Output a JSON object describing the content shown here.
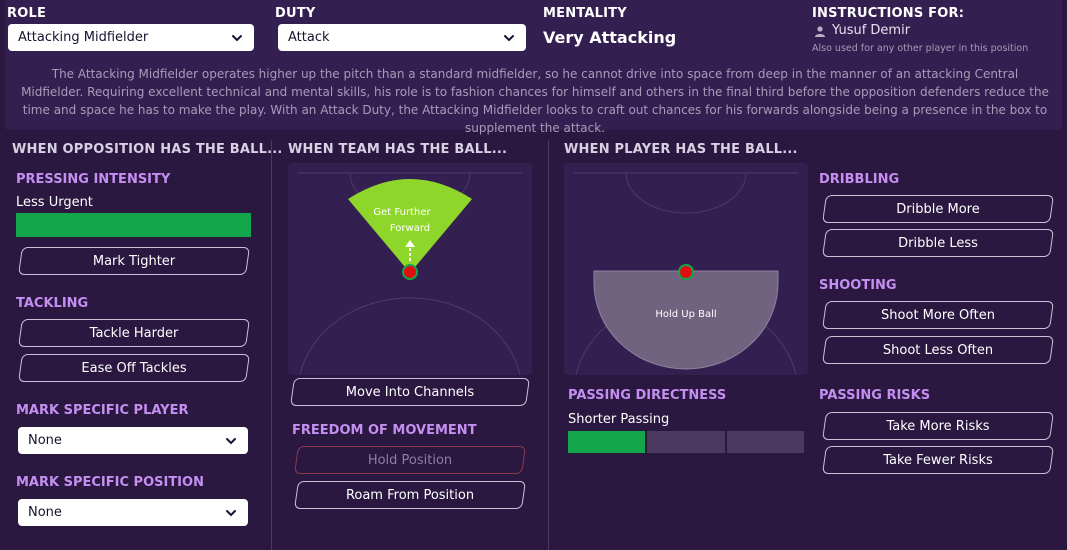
{
  "header": {
    "role_label": "ROLE",
    "role_value": "Attacking Midfielder",
    "duty_label": "DUTY",
    "duty_value": "Attack",
    "mentality_label": "MENTALITY",
    "mentality_value": "Very Attacking",
    "instructions_label": "INSTRUCTIONS FOR:",
    "player_name": "Yusuf Demir",
    "player_note": "Also used for any other player in this position"
  },
  "description": "The Attacking Midfielder operates higher up the pitch than a standard midfielder, so he cannot drive into space from deep in the manner of an attacking Central Midfielder. Requiring excellent technical and mental skills, his role is to fashion chances for himself and others in the final third before the opposition defenders reduce the time and space he has to make the play. With an Attack Duty, the Attacking Midfielder looks to craft out chances for his forwards alongside being a presence in the box to supplement the attack.",
  "opposition": {
    "title": "WHEN OPPOSITION HAS THE BALL...",
    "pressing_title": "PRESSING INTENSITY",
    "pressing_value": "Less Urgent",
    "pressing_level": 1.0,
    "mark_tighter": "Mark Tighter",
    "tackling_title": "TACKLING",
    "tackle_harder": "Tackle Harder",
    "ease_off": "Ease Off Tackles",
    "mark_player_title": "MARK SPECIFIC PLAYER",
    "mark_player_value": "None",
    "mark_position_title": "MARK SPECIFIC POSITION",
    "mark_position_value": "None"
  },
  "team": {
    "title": "WHEN TEAM HAS THE BALL...",
    "zone_label_1": "Get Further",
    "zone_label_2": "Forward",
    "channels": "Move Into Channels",
    "freedom_title": "FREEDOM OF MOVEMENT",
    "hold_position": "Hold Position",
    "roam": "Roam From Position"
  },
  "player": {
    "title": "WHEN PLAYER HAS THE BALL...",
    "hold_up": "Hold Up Ball",
    "passing_title": "PASSING DIRECTNESS",
    "passing_value": "Shorter Passing",
    "passing_level": 1,
    "passing_segments": 3,
    "dribbling_title": "DRIBBLING",
    "dribble_more": "Dribble More",
    "dribble_less": "Dribble Less",
    "shooting_title": "SHOOTING",
    "shoot_more": "Shoot More Often",
    "shoot_less": "Shoot Less Often",
    "risks_title": "PASSING RISKS",
    "more_risks": "Take More Risks",
    "fewer_risks": "Take Fewer Risks"
  },
  "colors": {
    "accent_green": "#14a64a",
    "zone_green": "#8fd62a",
    "subtitle_purple": "#c48ff0",
    "player_dot": "#e01010"
  },
  "icons": [
    "chevron-down-icon",
    "user-icon",
    "arrow-up-icon"
  ]
}
